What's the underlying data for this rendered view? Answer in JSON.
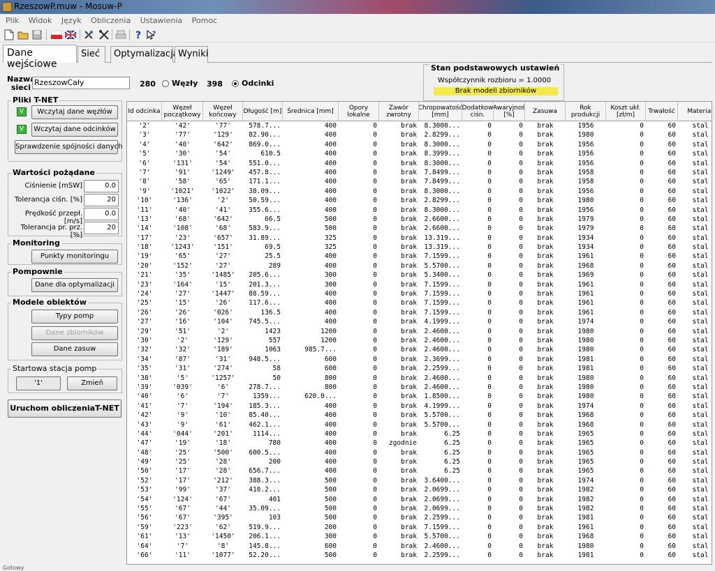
{
  "window": {
    "title": "RzeszowP.muw - Mosuw-P"
  },
  "menu": [
    "Plik",
    "Widok",
    "Język",
    "Obliczenia",
    "Ustawienia",
    "Pomoc"
  ],
  "tabs": [
    {
      "label": "Dane wejściowe",
      "active": true
    },
    {
      "label": "Sieć",
      "active": false
    },
    {
      "label": "Optymalizacja",
      "active": false
    },
    {
      "label": "Wyniki",
      "active": false
    }
  ],
  "network": {
    "label": "Nazwa sieci",
    "name": "RzeszowCały",
    "nodes_count": "280",
    "nodes_label": "Węzły",
    "segments_count": "398",
    "segments_label": "Odcinki",
    "selected": "Odcinki"
  },
  "status_panel": {
    "title": "Stan podstawowych ustawień",
    "coefficient": "Współczynnik rozbioru = 1.0000",
    "warning": "Brak modeli zbiorników",
    "warning_color": "#f2e94a"
  },
  "tnet": {
    "title": "Pliki T-NET",
    "load_nodes": "Wczytaj dane węzłów",
    "load_segments": "Wczytaj dane odcinków",
    "check": "Sprawdzenie spójności danych",
    "check_mark": "V"
  },
  "desired": {
    "title": "Wartości pożądane",
    "pressure_label": "Ciśnienie [mSW]",
    "pressure": "0.0",
    "pressure_tol_label": "Tolerancja ciśn. [%]",
    "pressure_tol": "20",
    "velocity_label": "Prędkość przepł. [m/s]",
    "velocity": "0.0",
    "velocity_tol_label": "Tolerancja pr. prz. [%]",
    "velocity_tol": "20"
  },
  "monitoring": {
    "title": "Monitoring",
    "button": "Punkty monitoringu"
  },
  "pumps": {
    "title": "Pompownie",
    "button": "Dane dla optymalizacji"
  },
  "models": {
    "title": "Modele obiektów",
    "pump_types": "Typy pomp",
    "tanks": "Dane zbiorników",
    "valves": "Dane zasuw"
  },
  "start_station": {
    "title": "Startowa stacja pomp",
    "value": "'1'",
    "change": "Zmień"
  },
  "run_button": "Uruchom obliczeniaT-NET",
  "statusbar": "Gotowy",
  "table": {
    "columns": [
      {
        "label": "Id odcinka",
        "width": 50
      },
      {
        "label": "Węzeł początkowy",
        "width": 59
      },
      {
        "label": "Węzeł końcowy",
        "width": 57
      },
      {
        "label": "Długość [m]",
        "width": 57
      },
      {
        "label": "Średnica [mm]",
        "width": 80
      },
      {
        "label": "Opory lokalne",
        "width": 58
      },
      {
        "label": "Zawór zwrotny",
        "width": 57
      },
      {
        "label": "Chropowatość [mm]",
        "width": 62
      },
      {
        "label": "Dodatkow ciśn.",
        "width": 45
      },
      {
        "label": "Awaryjnoś [%]",
        "width": 45
      },
      {
        "label": "Zasuwa",
        "width": 58
      },
      {
        "label": "Rok produkcji",
        "width": 58
      },
      {
        "label": "Koszt ukł. [zł/m]",
        "width": 57
      },
      {
        "label": "Trwałość",
        "width": 46
      },
      {
        "label": "Materiał",
        "width": 64
      }
    ],
    "rows": [
      [
        "'2'",
        "'42'",
        "'77'",
        "578.7...",
        "400",
        "0",
        "brak",
        "8.3000...",
        "0",
        "0",
        "brak",
        "1956",
        "0",
        "60",
        "stal"
      ],
      [
        "'3'",
        "'77'",
        "'129'",
        "82.90...",
        "400",
        "0",
        "brak",
        "2.8299...",
        "0",
        "0",
        "brak",
        "1980",
        "0",
        "60",
        "stal"
      ],
      [
        "'4'",
        "'40'",
        "'642'",
        "869.0...",
        "400",
        "0",
        "brak",
        "8.3000...",
        "0",
        "0",
        "brak",
        "1956",
        "0",
        "60",
        "stal"
      ],
      [
        "'5'",
        "'30'",
        "'54'",
        "610.5",
        "400",
        "0",
        "brak",
        "8.3999...",
        "0",
        "0",
        "brak",
        "1956",
        "0",
        "60",
        "stal"
      ],
      [
        "'6'",
        "'131'",
        "'54'",
        "551.0...",
        "400",
        "0",
        "brak",
        "8.3000...",
        "0",
        "0",
        "brak",
        "1956",
        "0",
        "60",
        "stal"
      ],
      [
        "'7'",
        "'91'",
        "'1249'",
        "457.8...",
        "400",
        "0",
        "brak",
        "7.8499...",
        "0",
        "0",
        "brak",
        "1958",
        "0",
        "60",
        "stal"
      ],
      [
        "'8'",
        "'58'",
        "'65'",
        "171.1...",
        "400",
        "0",
        "brak",
        "7.8499...",
        "0",
        "0",
        "brak",
        "1958",
        "0",
        "60",
        "stal"
      ],
      [
        "'9'",
        "'1021'",
        "'1022'",
        "38.09...",
        "400",
        "0",
        "brak",
        "8.3000...",
        "0",
        "0",
        "brak",
        "1956",
        "0",
        "60",
        "stal"
      ],
      [
        "'10'",
        "'136'",
        "'2'",
        "50.59...",
        "400",
        "0",
        "brak",
        "2.8299...",
        "0",
        "0",
        "brak",
        "1980",
        "0",
        "60",
        "stal"
      ],
      [
        "'11'",
        "'40'",
        "'41'",
        "355.6...",
        "400",
        "0",
        "brak",
        "8.3000...",
        "0",
        "0",
        "brak",
        "1956",
        "0",
        "60",
        "stal"
      ],
      [
        "'13'",
        "'68'",
        "'642'",
        "66.5",
        "500",
        "0",
        "brak",
        "2.6600...",
        "0",
        "0",
        "brak",
        "1979",
        "0",
        "60",
        "stal"
      ],
      [
        "'14'",
        "'108'",
        "'68'",
        "583.9...",
        "500",
        "0",
        "brak",
        "2.6600...",
        "0",
        "0",
        "brak",
        "1979",
        "0",
        "60",
        "stal"
      ],
      [
        "'17'",
        "'23'",
        "'657'",
        "31.89...",
        "325",
        "0",
        "brak",
        "13.319...",
        "0",
        "0",
        "brak",
        "1934",
        "0",
        "60",
        "stal"
      ],
      [
        "'18'",
        "'1243'",
        "'151'",
        "69.5",
        "325",
        "0",
        "brak",
        "13.319...",
        "0",
        "0",
        "brak",
        "1934",
        "0",
        "60",
        "stal"
      ],
      [
        "'19'",
        "'65'",
        "'27'",
        "25.5",
        "400",
        "0",
        "brak",
        "7.1599...",
        "0",
        "0",
        "brak",
        "1961",
        "0",
        "60",
        "stal"
      ],
      [
        "'20'",
        "'152'",
        "'27'",
        "289",
        "400",
        "0",
        "brak",
        "5.5700...",
        "0",
        "0",
        "brak",
        "1968",
        "0",
        "60",
        "stal"
      ],
      [
        "'21'",
        "'35'",
        "'1485'",
        "205.6...",
        "300",
        "0",
        "brak",
        "5.3400...",
        "0",
        "0",
        "brak",
        "1969",
        "0",
        "60",
        "stal"
      ],
      [
        "'23'",
        "'164'",
        "'15'",
        "201.3...",
        "300",
        "0",
        "brak",
        "7.1599...",
        "0",
        "0",
        "brak",
        "1961",
        "0",
        "60",
        "stal"
      ],
      [
        "'24'",
        "'27'",
        "'1447'",
        "88.59...",
        "400",
        "0",
        "brak",
        "7.1599...",
        "0",
        "0",
        "brak",
        "1961",
        "0",
        "60",
        "stal"
      ],
      [
        "'25'",
        "'15'",
        "'26'",
        "117.6...",
        "400",
        "0",
        "brak",
        "7.1599...",
        "0",
        "0",
        "brak",
        "1961",
        "0",
        "60",
        "stal"
      ],
      [
        "'26'",
        "'26'",
        "'026'",
        "136.5",
        "400",
        "0",
        "brak",
        "7.1599...",
        "0",
        "0",
        "brak",
        "1961",
        "0",
        "60",
        "stal"
      ],
      [
        "'27'",
        "'16'",
        "'104'",
        "745.5...",
        "400",
        "0",
        "brak",
        "4.1999...",
        "0",
        "0",
        "brak",
        "1974",
        "0",
        "60",
        "stal"
      ],
      [
        "'29'",
        "'51'",
        "'2'",
        "1423",
        "1200",
        "0",
        "brak",
        "2.4600...",
        "0",
        "0",
        "brak",
        "1980",
        "0",
        "60",
        "stal"
      ],
      [
        "'30'",
        "'2'",
        "'129'",
        "557",
        "1200",
        "0",
        "brak",
        "2.4600...",
        "0",
        "0",
        "brak",
        "1980",
        "0",
        "60",
        "stal"
      ],
      [
        "'32'",
        "'32'",
        "'189'",
        "1063",
        "985.7...",
        "0",
        "brak",
        "2.4600...",
        "0",
        "0",
        "brak",
        "1980",
        "0",
        "60",
        "stal"
      ],
      [
        "'34'",
        "'87'",
        "'31'",
        "948.5...",
        "600",
        "0",
        "brak",
        "2.3699...",
        "0",
        "0",
        "brak",
        "1981",
        "0",
        "60",
        "stal"
      ],
      [
        "'35'",
        "'31'",
        "'274'",
        "58",
        "600",
        "0",
        "brak",
        "2.2599...",
        "0",
        "0",
        "brak",
        "1981",
        "0",
        "60",
        "stal"
      ],
      [
        "'38'",
        "'5'",
        "'1257'",
        "50",
        "800",
        "0",
        "brak",
        "2.4600...",
        "0",
        "0",
        "brak",
        "1980",
        "0",
        "60",
        "stal"
      ],
      [
        "'39'",
        "'039'",
        "'6'",
        "278.7...",
        "800",
        "0",
        "brak",
        "2.4600...",
        "0",
        "0",
        "brak",
        "1980",
        "0",
        "60",
        "stal"
      ],
      [
        "'40'",
        "'6'",
        "'7'",
        "1359...",
        "620.0...",
        "0",
        "brak",
        "1.8500...",
        "0",
        "0",
        "brak",
        "1980",
        "0",
        "60",
        "stal"
      ],
      [
        "'41'",
        "'7'",
        "'194'",
        "185.3...",
        "400",
        "0",
        "brak",
        "4.1999...",
        "0",
        "0",
        "brak",
        "1974",
        "0",
        "60",
        "stal"
      ],
      [
        "'42'",
        "'9'",
        "'10'",
        "85.40...",
        "400",
        "0",
        "brak",
        "5.5700...",
        "0",
        "0",
        "brak",
        "1968",
        "0",
        "60",
        "stal"
      ],
      [
        "'43'",
        "'9'",
        "'61'",
        "462.1...",
        "400",
        "0",
        "brak",
        "5.5700...",
        "0",
        "0",
        "brak",
        "1968",
        "0",
        "60",
        "stal"
      ],
      [
        "'44'",
        "'044'",
        "'201'",
        "1114...",
        "400",
        "0",
        "brak",
        "6.25",
        "0",
        "0",
        "brak",
        "1965",
        "0",
        "60",
        "stal"
      ],
      [
        "'47'",
        "'19'",
        "'18'",
        "780",
        "400",
        "0",
        "zgodnie",
        "6.25",
        "0",
        "0",
        "brak",
        "1965",
        "0",
        "60",
        "stal"
      ],
      [
        "'48'",
        "'25'",
        "'500'",
        "600.5...",
        "400",
        "0",
        "brak",
        "6.25",
        "0",
        "0",
        "brak",
        "1965",
        "0",
        "60",
        "stal"
      ],
      [
        "'49'",
        "'25'",
        "'28'",
        "200",
        "400",
        "0",
        "brak",
        "6.25",
        "0",
        "0",
        "brak",
        "1965",
        "0",
        "60",
        "stal"
      ],
      [
        "'50'",
        "'17'",
        "'28'",
        "656.7...",
        "400",
        "0",
        "brak",
        "6.25",
        "0",
        "0",
        "brak",
        "1965",
        "0",
        "60",
        "stal"
      ],
      [
        "'52'",
        "'17'",
        "'212'",
        "388.3...",
        "500",
        "0",
        "brak",
        "3.6400...",
        "0",
        "0",
        "brak",
        "1974",
        "0",
        "60",
        "stal"
      ],
      [
        "'53'",
        "'99'",
        "'37'",
        "410.2...",
        "500",
        "0",
        "brak",
        "2.0699...",
        "0",
        "0",
        "brak",
        "1982",
        "0",
        "60",
        "stal"
      ],
      [
        "'54'",
        "'124'",
        "'67'",
        "401",
        "500",
        "0",
        "brak",
        "2.0699...",
        "0",
        "0",
        "brak",
        "1982",
        "0",
        "60",
        "stal"
      ],
      [
        "'55'",
        "'67'",
        "'44'",
        "35.09...",
        "500",
        "0",
        "brak",
        "2.0699...",
        "0",
        "0",
        "brak",
        "1982",
        "0",
        "60",
        "stal"
      ],
      [
        "'56'",
        "'67'",
        "'395'",
        "103",
        "500",
        "0",
        "brak",
        "2.2599...",
        "0",
        "0",
        "brak",
        "1981",
        "0",
        "60",
        "stal"
      ],
      [
        "'59'",
        "'223'",
        "'62'",
        "519.9...",
        "200",
        "0",
        "brak",
        "7.1599...",
        "0",
        "0",
        "brak",
        "1961",
        "0",
        "60",
        "stal"
      ],
      [
        "'61'",
        "'13'",
        "'1450'",
        "206.1...",
        "300",
        "0",
        "brak",
        "5.5700...",
        "0",
        "0",
        "brak",
        "1968",
        "0",
        "60",
        "stal"
      ],
      [
        "'64'",
        "'7'",
        "'8'",
        "145.8...",
        "600",
        "0",
        "brak",
        "2.4600...",
        "0",
        "0",
        "brak",
        "1980",
        "0",
        "60",
        "stal"
      ],
      [
        "'66'",
        "'11'",
        "'1077'",
        "52.20...",
        "500",
        "0",
        "brak",
        "2.2599...",
        "0",
        "0",
        "brak",
        "1981",
        "0",
        "60",
        "stal"
      ]
    ]
  }
}
